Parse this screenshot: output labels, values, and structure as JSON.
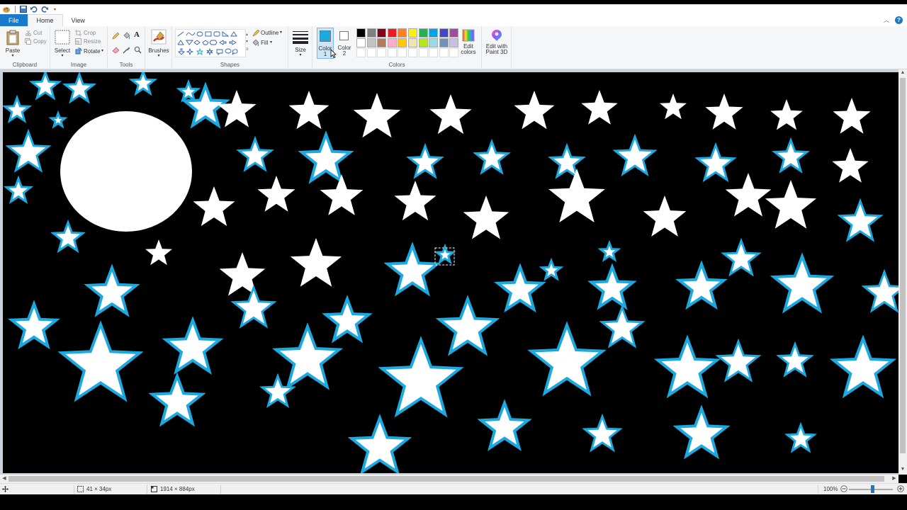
{
  "tabs": {
    "file": "File",
    "home": "Home",
    "view": "View"
  },
  "clipboard": {
    "paste": "Paste",
    "cut": "Cut",
    "copy": "Copy",
    "label": "Clipboard"
  },
  "image": {
    "crop": "Crop",
    "resize": "Resize",
    "select": "Select",
    "rotate": "Rotate",
    "label": "Image"
  },
  "tools": {
    "label": "Tools",
    "text_tool": "A"
  },
  "brushes": {
    "label": "Brushes"
  },
  "shapes": {
    "outline": "Outline",
    "fill": "Fill",
    "label": "Shapes"
  },
  "size": {
    "label": "Size"
  },
  "color1": {
    "line1": "Color",
    "line2": "1",
    "value": "#1ca9e0"
  },
  "color2": {
    "line1": "Color",
    "line2": "2",
    "value": "#ffffff"
  },
  "edit_colors": {
    "line1": "Edit",
    "line2": "colors"
  },
  "paint3d": {
    "line1": "Edit with",
    "line2": "Paint 3D"
  },
  "colors": {
    "label": "Colors"
  },
  "palette_row1": [
    "#000000",
    "#7f7f7f",
    "#880015",
    "#ed1c24",
    "#ff7f27",
    "#fff200",
    "#22b14c",
    "#00a2e8",
    "#3f48cc",
    "#a349a4"
  ],
  "palette_row2": [
    "#ffffff",
    "#c3c3c3",
    "#b97a57",
    "#ffaec9",
    "#ffc90e",
    "#efe4b0",
    "#b5e61d",
    "#99d9ea",
    "#7092be",
    "#c8bfe7"
  ],
  "theme": {
    "accent": "#1979ca",
    "star_outline": "#1ca9e0",
    "star_fill": "#ffffff",
    "canvas_bg": "#000000"
  },
  "status": {
    "selection_size": "41 × 34px",
    "image_size": "1914 × 884px",
    "zoom": "100%"
  }
}
